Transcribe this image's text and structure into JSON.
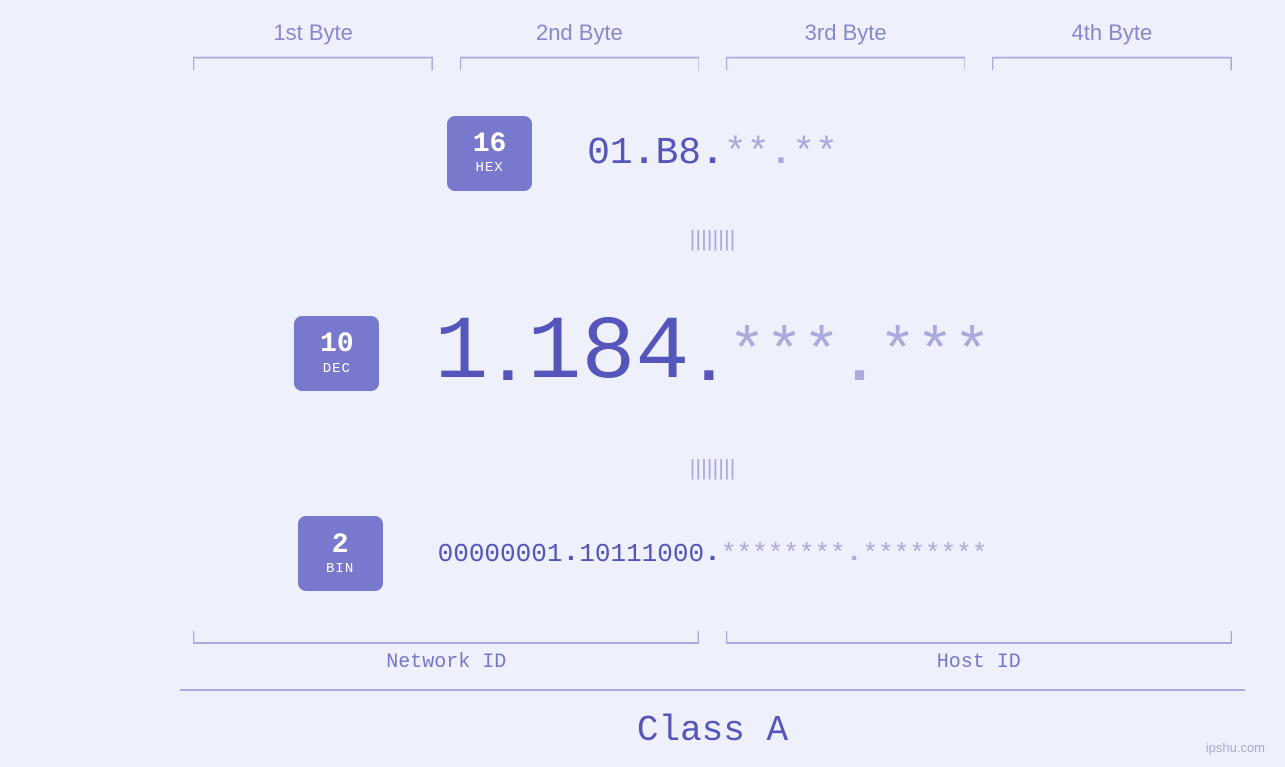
{
  "byte_headers": [
    "1st Byte",
    "2nd Byte",
    "3rd Byte",
    "4th Byte"
  ],
  "rows": [
    {
      "label_number": "16",
      "label_base": "HEX",
      "values": [
        "01",
        "B8",
        "**",
        "**"
      ],
      "masked": [
        false,
        false,
        true,
        true
      ],
      "size_class": "hex",
      "dot_class": "hex"
    },
    {
      "label_number": "10",
      "label_base": "DEC",
      "values": [
        "1",
        "184.",
        "***",
        "***"
      ],
      "values_split": [
        [
          "1"
        ],
        [
          "184"
        ],
        [
          "***"
        ],
        [
          "***"
        ]
      ],
      "masked": [
        false,
        false,
        true,
        true
      ],
      "size_class": "dec",
      "dot_class": "dec"
    },
    {
      "label_number": "2",
      "label_base": "BIN",
      "values": [
        "00000001",
        "10111000",
        "********",
        "********"
      ],
      "masked": [
        false,
        false,
        true,
        true
      ],
      "size_class": "bin",
      "dot_class": "bin"
    }
  ],
  "equals_symbol": "||",
  "network_id_label": "Network ID",
  "host_id_label": "Host ID",
  "class_label": "Class A",
  "watermark": "ipshu.com",
  "accent_color": "#5555bb",
  "label_color": "#7777cc",
  "muted_color": "#aaaadd",
  "label_bg": "#7878cc"
}
